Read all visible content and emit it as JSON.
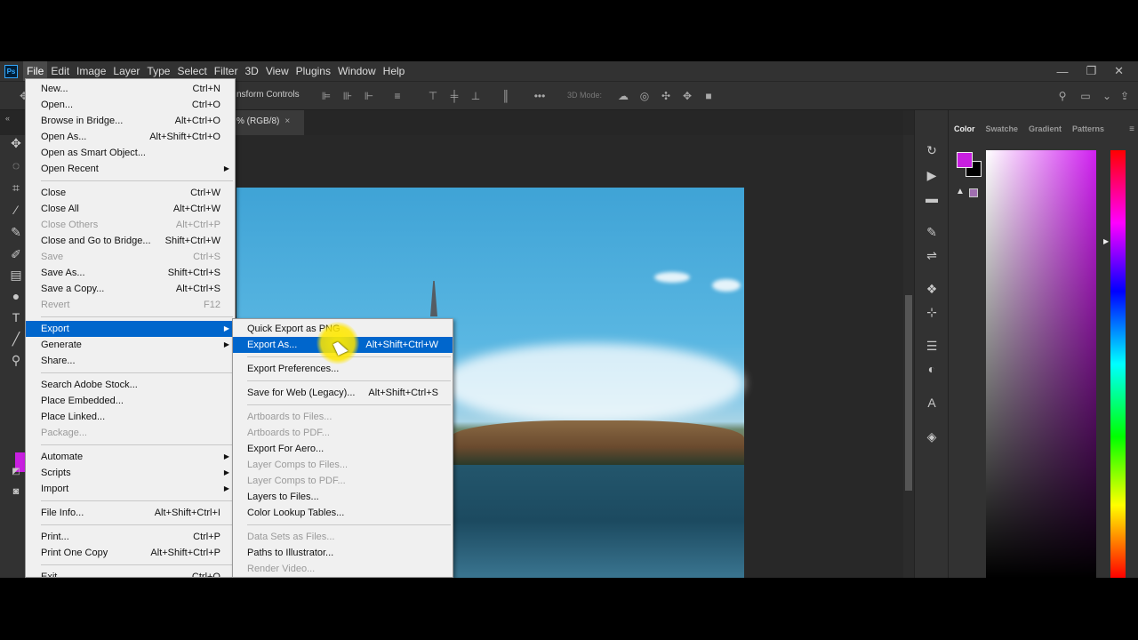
{
  "menubar": {
    "logo": "Ps",
    "items": [
      "File",
      "Edit",
      "Image",
      "Layer",
      "Type",
      "Select",
      "Filter",
      "3D",
      "View",
      "Plugins",
      "Window",
      "Help"
    ],
    "window_controls": [
      "—",
      "❐",
      "✕"
    ]
  },
  "options_bar": {
    "transform_label": "nsform Controls",
    "mode_3d": "3D Mode:"
  },
  "document_tab": {
    "label": "% (RGB/8)",
    "close": "×"
  },
  "color_panel": {
    "tabs": [
      "Color",
      "Swatche",
      "Gradient",
      "Patterns"
    ],
    "foreground": "#c81fe0",
    "background": "#000000"
  },
  "file_menu": {
    "group1": [
      {
        "label": "New...",
        "shortcut": "Ctrl+N"
      },
      {
        "label": "Open...",
        "shortcut": "Ctrl+O"
      },
      {
        "label": "Browse in Bridge...",
        "shortcut": "Alt+Ctrl+O"
      },
      {
        "label": "Open As...",
        "shortcut": "Alt+Shift+Ctrl+O"
      },
      {
        "label": "Open as Smart Object...",
        "shortcut": ""
      },
      {
        "label": "Open Recent",
        "shortcut": ""
      }
    ],
    "group2": [
      {
        "label": "Close",
        "shortcut": "Ctrl+W"
      },
      {
        "label": "Close All",
        "shortcut": "Alt+Ctrl+W"
      },
      {
        "label": "Close Others",
        "shortcut": "Alt+Ctrl+P"
      },
      {
        "label": "Close and Go to Bridge...",
        "shortcut": "Shift+Ctrl+W"
      },
      {
        "label": "Save",
        "shortcut": "Ctrl+S"
      },
      {
        "label": "Save As...",
        "shortcut": "Shift+Ctrl+S"
      },
      {
        "label": "Save a Copy...",
        "shortcut": "Alt+Ctrl+S"
      },
      {
        "label": "Revert",
        "shortcut": "F12"
      }
    ],
    "group3": [
      {
        "label": "Export"
      },
      {
        "label": "Generate"
      },
      {
        "label": "Share..."
      }
    ],
    "group4": [
      {
        "label": "Search Adobe Stock..."
      },
      {
        "label": "Place Embedded..."
      },
      {
        "label": "Place Linked..."
      },
      {
        "label": "Package..."
      }
    ],
    "group5": [
      {
        "label": "Automate"
      },
      {
        "label": "Scripts"
      },
      {
        "label": "Import"
      }
    ],
    "group6": [
      {
        "label": "File Info...",
        "shortcut": "Alt+Shift+Ctrl+I"
      }
    ],
    "group7": [
      {
        "label": "Print...",
        "shortcut": "Ctrl+P"
      },
      {
        "label": "Print One Copy",
        "shortcut": "Alt+Shift+Ctrl+P"
      }
    ],
    "group8": [
      {
        "label": "Exit",
        "shortcut": "Ctrl+Q"
      }
    ]
  },
  "export_menu": {
    "group1": [
      {
        "label": "Quick Export as PNG",
        "shortcut": ""
      },
      {
        "label": "Export As...",
        "shortcut": "Alt+Shift+Ctrl+W"
      }
    ],
    "group2": [
      {
        "label": "Export Preferences..."
      }
    ],
    "group3": [
      {
        "label": "Save for Web (Legacy)...",
        "shortcut": "Alt+Shift+Ctrl+S"
      }
    ],
    "group4": [
      {
        "label": "Artboards to Files..."
      },
      {
        "label": "Artboards to PDF..."
      },
      {
        "label": "Export For Aero..."
      },
      {
        "label": "Layer Comps to Files..."
      },
      {
        "label": "Layer Comps to PDF..."
      },
      {
        "label": "Layers to Files..."
      },
      {
        "label": "Color Lookup Tables..."
      }
    ],
    "group5": [
      {
        "label": "Data Sets as Files..."
      },
      {
        "label": "Paths to Illustrator..."
      },
      {
        "label": "Render Video..."
      }
    ]
  }
}
